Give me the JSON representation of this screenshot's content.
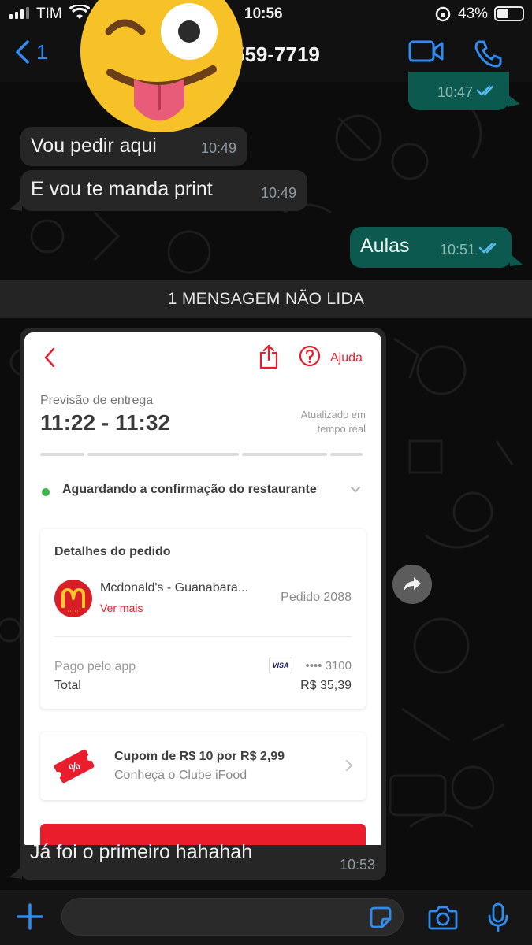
{
  "status_bar": {
    "carrier": "TIM",
    "time": "10:56",
    "battery": "43%"
  },
  "header": {
    "back_count": "1",
    "contact_partial": "559-7719"
  },
  "messages": [
    {
      "direction": "out",
      "text": "",
      "time": "10:47",
      "read": true
    },
    {
      "direction": "in",
      "text": "Vou pedir aqui",
      "time": "10:49"
    },
    {
      "direction": "in",
      "text": "E vou te manda print",
      "time": "10:49"
    },
    {
      "direction": "out",
      "text": "Aulas",
      "time": "10:51",
      "read": true
    }
  ],
  "unread_banner": "1 MENSAGEM NÃO LIDA",
  "image_message": {
    "caption": "Já foi o primeiro hahahah",
    "time": "10:53",
    "screenshot": {
      "help_label": "Ajuda",
      "delivery_label": "Previsão de entrega",
      "delivery_window": "11:22 - 11:32",
      "updated_line1": "Atualizado em",
      "updated_line2": "tempo real",
      "status": "Aguardando a confirmação do restaurante",
      "status_color": "#3ab54a",
      "order_details_title": "Detalhes do pedido",
      "store_name": "Mcdonald's - Guanabara...",
      "see_more": "Ver mais",
      "order_number": "Pedido 2088",
      "paid_label": "Pago pelo app",
      "card_brand": "VISA",
      "card_number": "•••• 3100",
      "total_label": "Total",
      "total_value": "R$ 35,39",
      "coupon_title": "Cupom de R$ 10 por R$ 2,99",
      "coupon_subtitle": "Conheça o Clube iFood",
      "brand_color": "#ea1d2c"
    }
  },
  "colors": {
    "outgoing_bubble": "#0c5a4f",
    "incoming_bubble": "#262626",
    "accent_blue": "#2f8cf0",
    "read_ticks": "#53bdeb"
  },
  "icons": [
    "back-chevron-icon",
    "video-call-icon",
    "phone-call-icon",
    "plus-icon",
    "sticker-icon",
    "camera-icon",
    "microphone-icon",
    "forward-icon",
    "share-icon",
    "help-icon",
    "coupon-icon",
    "emoji-tongue-wink-icon"
  ]
}
